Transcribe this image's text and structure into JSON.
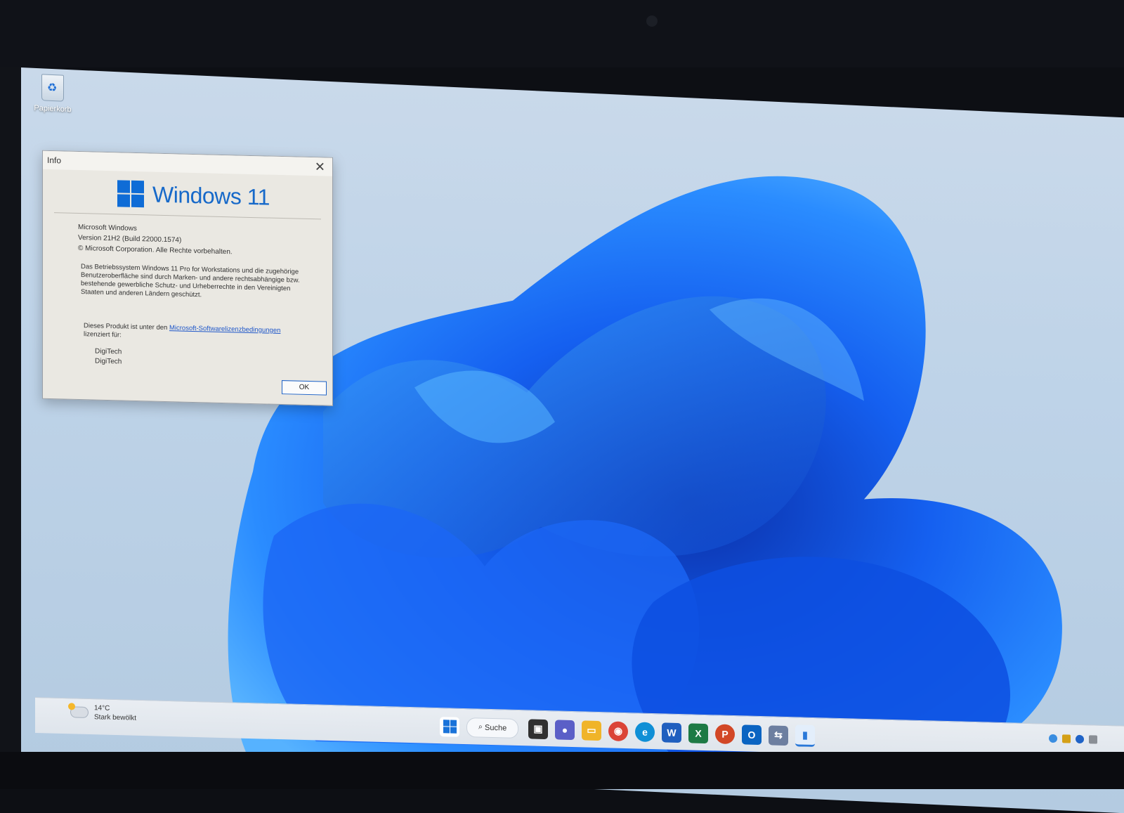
{
  "desktop": {
    "recycle_bin_label": "Papierkorb"
  },
  "dialog": {
    "title": "Info",
    "close_label": "✕",
    "logo_text": "Windows 11",
    "product_name": "Microsoft Windows",
    "version": "Version 21H2 (Build 22000.1574)",
    "copyright": "© Microsoft Corporation. Alle Rechte vorbehalten.",
    "legal_text": "Das Betriebssystem Windows 11 Pro for Workstations und die zugehörige Benutzeroberfläche sind durch Marken- und andere rechtsabhängige bzw. bestehende gewerbliche Schutz- und Urheberrechte in den Vereinigten Staaten und anderen Ländern geschützt.",
    "license_prefix": "Dieses Produkt ist unter den",
    "license_link": "Microsoft-Softwarelizenzbedingungen",
    "license_suffix": "lizenziert für:",
    "licensed_to": [
      "DigiTech",
      "DigiTech"
    ],
    "ok_label": "OK"
  },
  "taskbar": {
    "weather_temp": "14°C",
    "weather_desc": "Stark bewölkt",
    "search_label": "Suche",
    "icons": [
      {
        "name": "start-icon",
        "color": "#1a73d9"
      },
      {
        "name": "task-view-icon",
        "color": "#303030"
      },
      {
        "name": "teams-chat-icon",
        "color": "#5b5fc7"
      },
      {
        "name": "file-explorer-icon",
        "color": "#f0b429"
      },
      {
        "name": "chrome-icon",
        "color": "#db4437"
      },
      {
        "name": "edge-icon",
        "color": "#0f8fd6"
      },
      {
        "name": "word-icon",
        "color": "#1f5fbf"
      },
      {
        "name": "excel-icon",
        "color": "#1d7a45"
      },
      {
        "name": "powerpoint-icon",
        "color": "#d24726"
      },
      {
        "name": "outlook-icon",
        "color": "#0a64c2"
      },
      {
        "name": "network-app-icon",
        "color": "#6d7fa0"
      },
      {
        "name": "active-window-icon",
        "color": "#2a78d8"
      }
    ]
  },
  "colors": {
    "accent": "#0f6cd6",
    "bloom": "#1f6fff"
  }
}
